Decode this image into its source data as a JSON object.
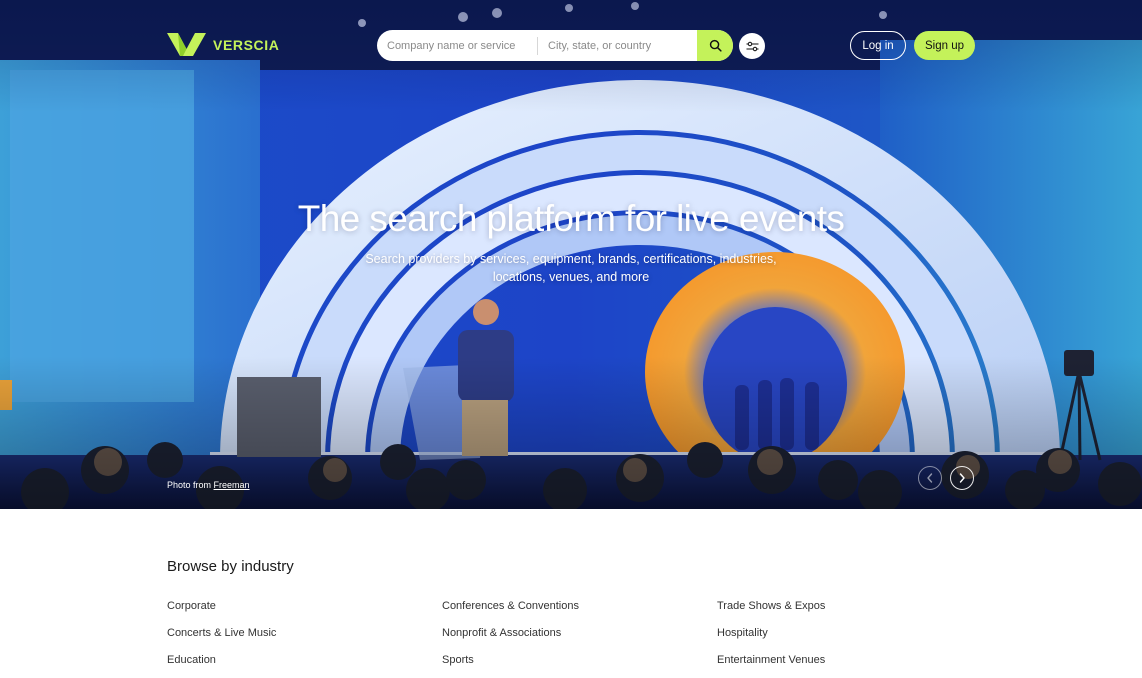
{
  "brand": {
    "name": "VERSCIA",
    "accent": "#c4f25a"
  },
  "search": {
    "company_placeholder": "Company name or service",
    "location_placeholder": "City, state, or country",
    "button_icon": "search-icon",
    "filter_icon": "sliders-icon"
  },
  "header": {
    "login_label": "Log in",
    "signup_label": "Sign up"
  },
  "hero": {
    "title": "The search platform for live events",
    "subtitle": "Search providers by services, equipment, brands, certifications, industries, locations, venues, and more",
    "credit_prefix": "Photo from",
    "credit_source": "Freeman",
    "prev_icon": "chevron-left-icon",
    "next_icon": "chevron-right-icon"
  },
  "browse": {
    "title": "Browse by industry",
    "industries": [
      "Corporate",
      "Conferences & Conventions",
      "Trade Shows & Expos",
      "Concerts & Live Music",
      "Nonprofit & Associations",
      "Hospitality",
      "Education",
      "Sports",
      "Entertainment Venues"
    ]
  }
}
